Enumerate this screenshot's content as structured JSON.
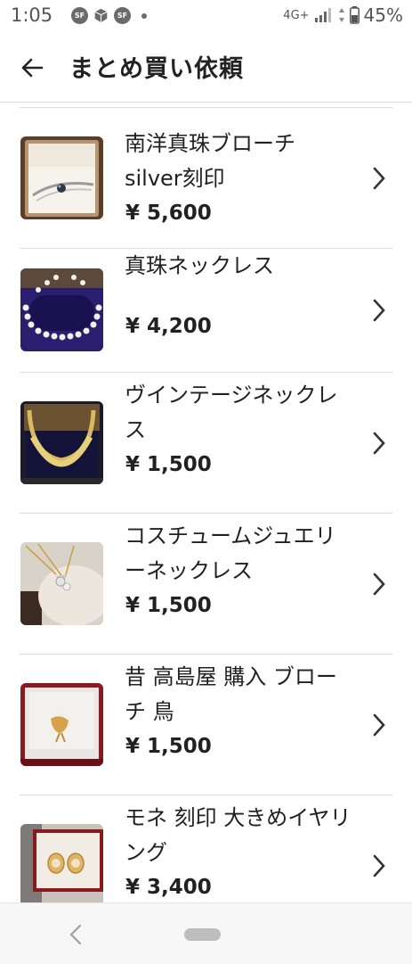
{
  "status_bar": {
    "time": "1:05",
    "notification_badge": "SF",
    "network": "4G+",
    "battery": "45%"
  },
  "header": {
    "title": "まとめ買い依頼"
  },
  "items": [
    {
      "name": "南洋真珠ブローチ silver刻印",
      "price": "¥ 5,600"
    },
    {
      "name": "真珠ネックレス",
      "price": "¥ 4,200"
    },
    {
      "name": "ヴインテージネックレス",
      "price": "¥ 1,500"
    },
    {
      "name": "コスチュームジュエリーネックレス",
      "price": "¥ 1,500"
    },
    {
      "name": "昔 高島屋 購入 ブローチ 鳥",
      "price": "¥ 1,500"
    },
    {
      "name": "モネ 刻印 大きめイヤリング",
      "price": "¥ 3,400"
    }
  ],
  "icons": {
    "back": "arrow-left-icon",
    "row_action": "chevron-right-icon",
    "nav_back": "nav-back-icon",
    "nav_home": "home-pill"
  },
  "colors": {
    "text": "#212121",
    "divider": "#dddddd",
    "chevron": "#333333"
  }
}
